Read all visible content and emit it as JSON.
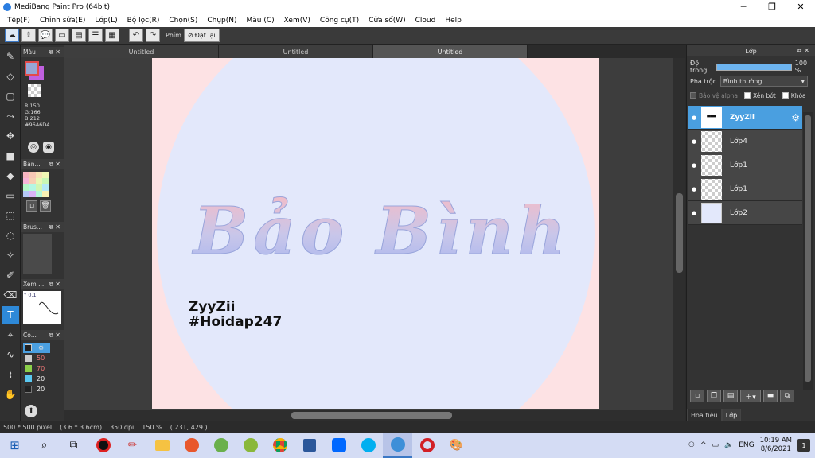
{
  "window": {
    "title": "MediBang Paint Pro (64bit)",
    "minimize": "─",
    "maximize": "❐",
    "close": "✕"
  },
  "menu": [
    "Tệp(F)",
    "Chỉnh sửa(E)",
    "Lớp(L)",
    "Bộ lọc(R)",
    "Chọn(S)",
    "Chụp(N)",
    "Màu (C)",
    "Xem(V)",
    "Công cụ(T)",
    "Cửa sổ(W)",
    "Cloud",
    "Help"
  ],
  "toolbar": {
    "phim_label": "Phím",
    "reset_label": "Đặt lại"
  },
  "panels": {
    "color": "Màu",
    "brush_palette": "Bản...",
    "brush": "Brus...",
    "navigator": "Xem ...",
    "navigator_value": "° 0.1",
    "colors": "Co..."
  },
  "color_info": {
    "r": "R:150",
    "g": "G:166",
    "b": "B:212",
    "hex": "#96A6D4",
    "fg_color": "#96a6d4",
    "bg_color": "#c060e0"
  },
  "palette_values": [
    "50",
    "70",
    "20",
    "20"
  ],
  "tabs": [
    "Untitled",
    "Untitled",
    "Untitled"
  ],
  "canvas": {
    "main_text": "Bảo Bình",
    "sig_line1": "ZyyZii",
    "sig_line2": "#Hoidap247"
  },
  "status": {
    "size": "500 * 500 pixel",
    "physical": "(3.6 * 3.6cm)",
    "dpi": "350 dpi",
    "zoom": "150 %",
    "coords": "( 231, 429 )"
  },
  "layer_panel": {
    "title": "Lớp",
    "opacity_label": "Độ trong",
    "opacity_value": "100 %",
    "opacity": 1.0,
    "blend_label": "Pha trộn",
    "blend_value": "Bình thường",
    "protect_alpha": "Bảo vệ alpha",
    "clipping": "Xén bớt",
    "lock": "Khóa",
    "layers": [
      {
        "name": "ZyyZii",
        "selected": true
      },
      {
        "name": "Lớp4",
        "selected": false
      },
      {
        "name": "Lớp1",
        "selected": false
      },
      {
        "name": "Lớp1",
        "selected": false
      },
      {
        "name": "Lớp2",
        "selected": false
      }
    ],
    "tab_navigator": "Hoa tiêu",
    "tab_layer": "Lớp"
  },
  "taskbar": {
    "lang": "ENG",
    "time": "10:19 AM",
    "date": "8/6/2021",
    "notifications": "1"
  }
}
